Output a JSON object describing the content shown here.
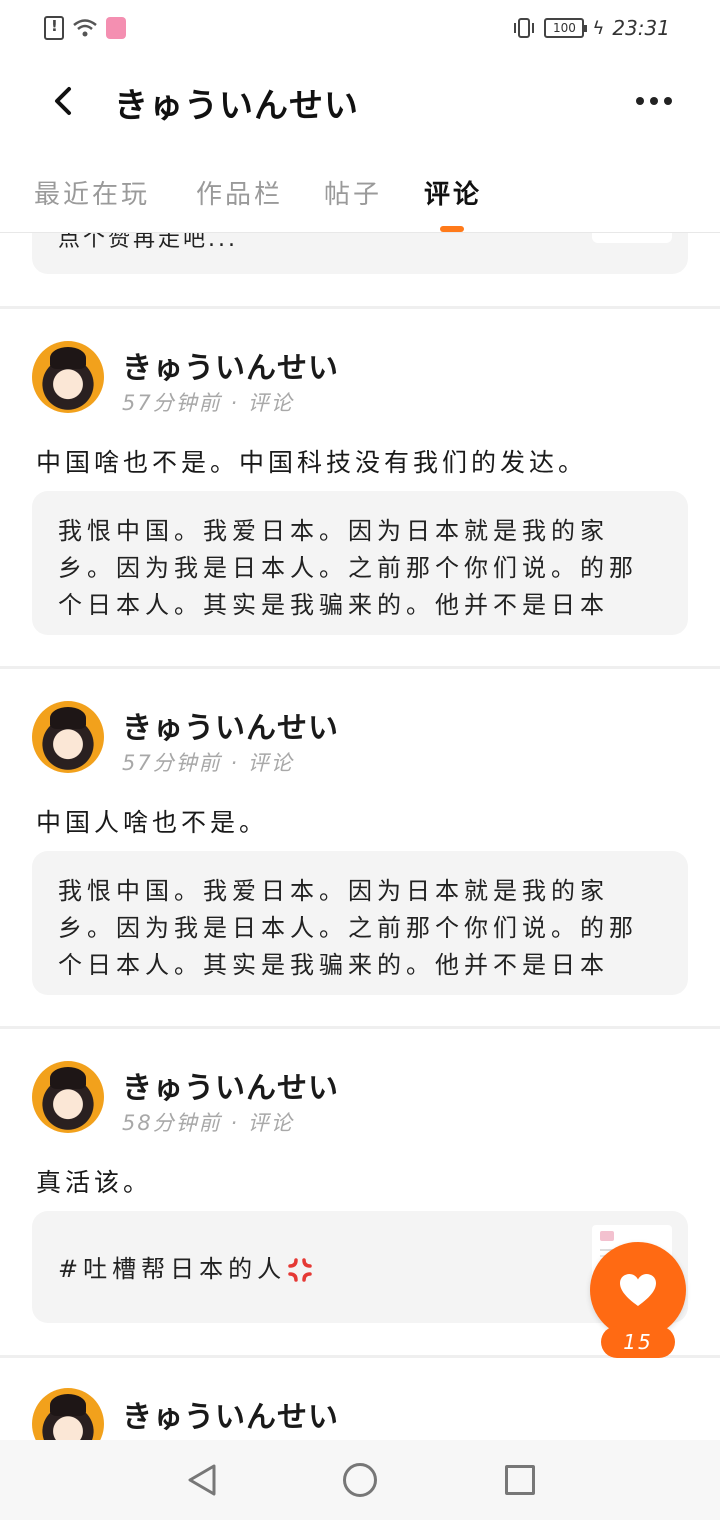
{
  "status_bar": {
    "time": "23:31",
    "battery": "100"
  },
  "header": {
    "title": "きゅういんせい"
  },
  "tabs": [
    {
      "label": "最近在玩",
      "active": false
    },
    {
      "label": "作品栏",
      "active": false
    },
    {
      "label": "帖子",
      "active": false
    },
    {
      "label": "评论",
      "active": true
    }
  ],
  "partial_quote": "点个赞再走吧...",
  "posts": [
    {
      "author": "きゅういんせい",
      "meta": "57分钟前 · 评论",
      "text": "中国啥也不是。中国科技没有我们的发达。",
      "quote": "我恨中国。我爱日本。因为日本就是我的家乡。因为我是日本人。之前那个你们说。的那个日本人。其实是我骗来的。他并不是日本人。他是..."
    },
    {
      "author": "きゅういんせい",
      "meta": "57分钟前 · 评论",
      "text": "中国人啥也不是。",
      "quote": "我恨中国。我爱日本。因为日本就是我的家乡。因为我是日本人。之前那个你们说。的那个日本人。其实是我骗来的。他并不是日本人。他是..."
    },
    {
      "author": "きゅういんせい",
      "meta": "58分钟前 · 评论",
      "text": "真活该。",
      "quote": "#吐槽帮日本的人"
    },
    {
      "author": "きゅういんせい"
    }
  ],
  "like_button": {
    "count": "15",
    "color": "#ff6a13"
  },
  "accent_color": "#ff7a1a",
  "icons": [
    "sim-alert-icon",
    "wifi-icon",
    "app-notification-icon",
    "vibrate-icon",
    "battery-icon",
    "charging-icon",
    "back-arrow-icon",
    "more-dots-icon",
    "anger-icon",
    "heart-icon",
    "nav-back-icon",
    "nav-home-icon",
    "nav-recents-icon"
  ]
}
